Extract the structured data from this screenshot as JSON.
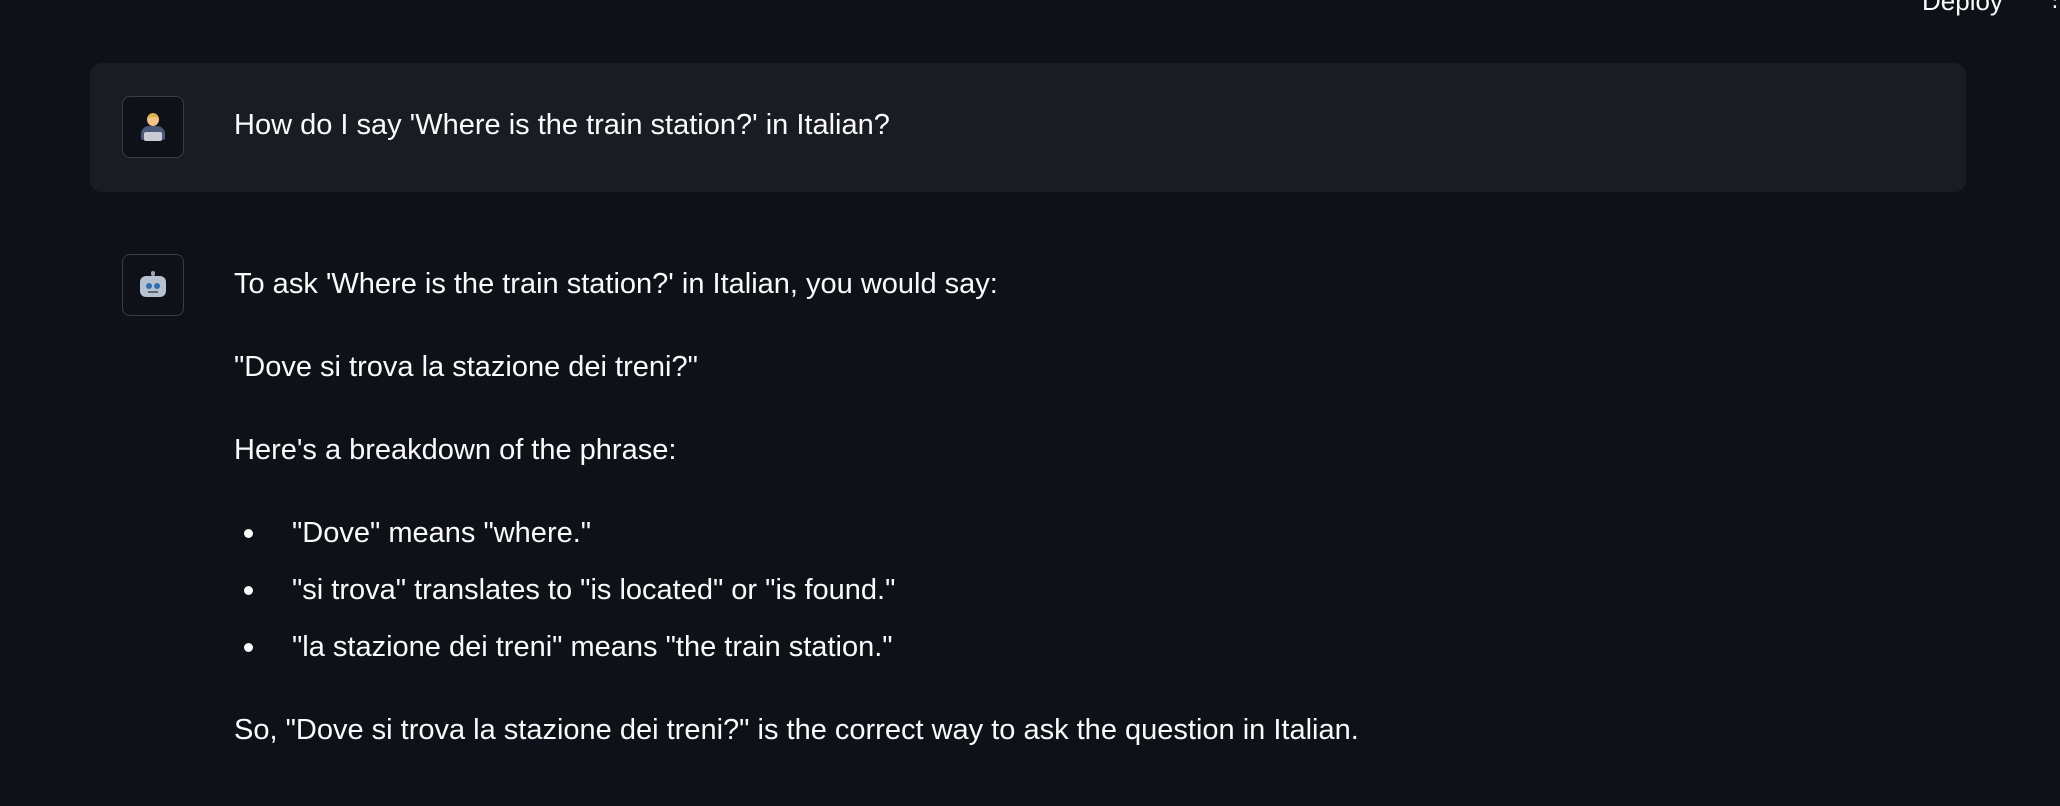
{
  "header": {
    "deploy_label": "Deploy",
    "menu_glyph": "⋮"
  },
  "chat": {
    "user_message": {
      "avatar_icon": "user-laptop-icon",
      "text": "How do I say 'Where is the train station?' in Italian?"
    },
    "assistant_message": {
      "avatar_icon": "robot-icon",
      "intro": "To ask 'Where is the train station?' in Italian, you would say:",
      "phrase": "\"Dove si trova la stazione dei treni?\"",
      "breakdown_heading": "Here's a breakdown of the phrase:",
      "bullets": [
        "\"Dove\" means \"where.\"",
        "\"si trova\" translates to \"is located\" or \"is found.\"",
        "\"la stazione dei treni\" means \"the train station.\""
      ],
      "conclusion": "So, \"Dove si trova la stazione dei treni?\" is the correct way to ask the question in Italian."
    }
  }
}
